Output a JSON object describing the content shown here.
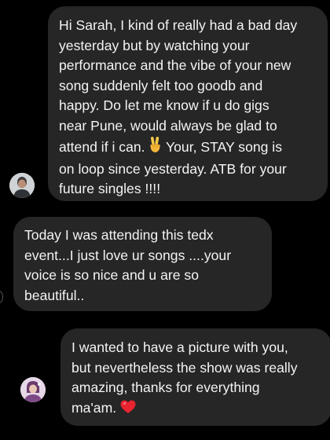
{
  "messages": [
    {
      "text_before_emoji": "Hi Sarah, I kind of really had a bad day\nyesterday but by watching your\nperformance and the vibe of your new\nsong suddenly felt too goodb and\nhappy. Do let me know if u do gigs\nnear Pune, would always be glad to\nattend if i can. ",
      "emoji": "victory-hand-icon",
      "text_after_emoji": " Your, STAY song is\non loop since yesterday. ATB for your\nfuture singles !!!!"
    },
    {
      "text": "Today I was attending this tedx\nevent...I just love ur songs ....your\nvoice is so nice and u are so\nbeautiful.."
    },
    {
      "text_before_emoji": "I wanted to have a picture with you,\nbut nevertheless the show was really\namazing, thanks for everything\nma'am. ",
      "emoji": "red-heart-icon"
    }
  ],
  "colors": {
    "background": "#000000",
    "bubble": "#262626",
    "text": "#f4f4f4",
    "heart": "#e8242f",
    "victory_hand": "#f7c948"
  }
}
